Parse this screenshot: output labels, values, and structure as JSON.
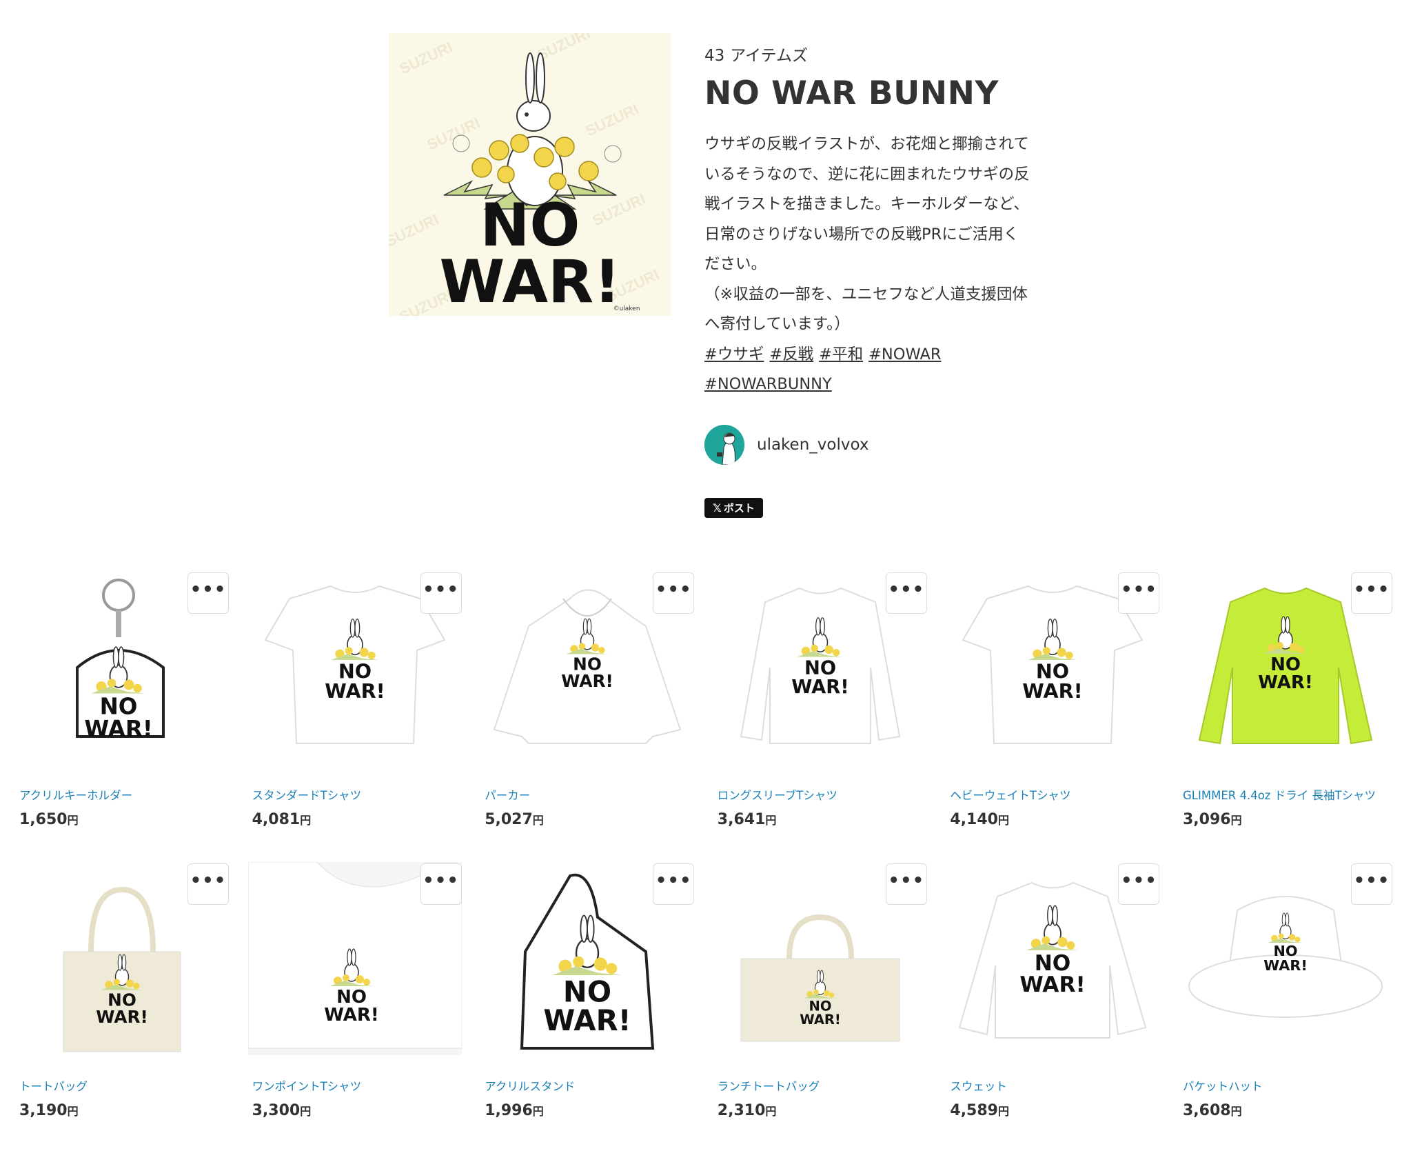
{
  "hero": {
    "item_count_number": "43",
    "item_count_label": "アイテムズ",
    "title": "NO WAR BUNNY",
    "description_lines": [
      "ウサギの反戦イラストが、お花畑と揶揄されて",
      "いるそうなので、逆に花に囲まれたウサギの反",
      "戦イラストを描きました。キーホルダーなど、",
      "日常のさりげない場所での反戦PRにご活用く",
      "ださい。",
      "（※収益の一部を、ユニセフなど人道支援団体",
      "へ寄付しています。）"
    ],
    "tags": [
      "#ウサギ",
      "#反戦",
      "#平和",
      "#NOWAR",
      "#NOWARBUNNY"
    ],
    "user_name": "ulaken_volvox",
    "post_button": "ポスト",
    "post_button_logo": "𝕏",
    "art_text_line1": "NO",
    "art_text_line2": "WAR!",
    "art_credit": "©ulaken",
    "art_watermark": "SUZURI"
  },
  "more_button_label": "•••",
  "currency_suffix": "円",
  "products": [
    {
      "name": "アクリルキーホルダー",
      "price": "1,650",
      "icon": "keychain-icon"
    },
    {
      "name": "スタンダードTシャツ",
      "price": "4,081",
      "icon": "tshirt-icon"
    },
    {
      "name": "パーカー",
      "price": "5,027",
      "icon": "hoodie-icon"
    },
    {
      "name": "ロングスリーブTシャツ",
      "price": "3,641",
      "icon": "longsleeve-icon"
    },
    {
      "name": "ヘビーウェイトTシャツ",
      "price": "4,140",
      "icon": "tshirt-icon"
    },
    {
      "name": "GLIMMER 4.4oz ドライ 長袖Tシャツ",
      "price": "3,096",
      "icon": "longsleeve-green-icon"
    },
    {
      "name": "トートバッグ",
      "price": "3,190",
      "icon": "tote-icon"
    },
    {
      "name": "ワンポイントTシャツ",
      "price": "3,300",
      "icon": "tshirt-closeup-icon"
    },
    {
      "name": "アクリルスタンド",
      "price": "1,996",
      "icon": "acrylic-stand-icon"
    },
    {
      "name": "ランチトートバッグ",
      "price": "2,310",
      "icon": "lunch-tote-icon"
    },
    {
      "name": "スウェット",
      "price": "4,589",
      "icon": "sweatshirt-icon"
    },
    {
      "name": "バケットハット",
      "price": "3,608",
      "icon": "bucket-hat-icon"
    }
  ],
  "colors": {
    "link_blue": "#1a7fb5",
    "art_bg": "#fbf8e8",
    "glimmer_green": "#c6ec3a",
    "avatar_teal": "#1fa59a",
    "canvas_beige": "#efead8"
  }
}
